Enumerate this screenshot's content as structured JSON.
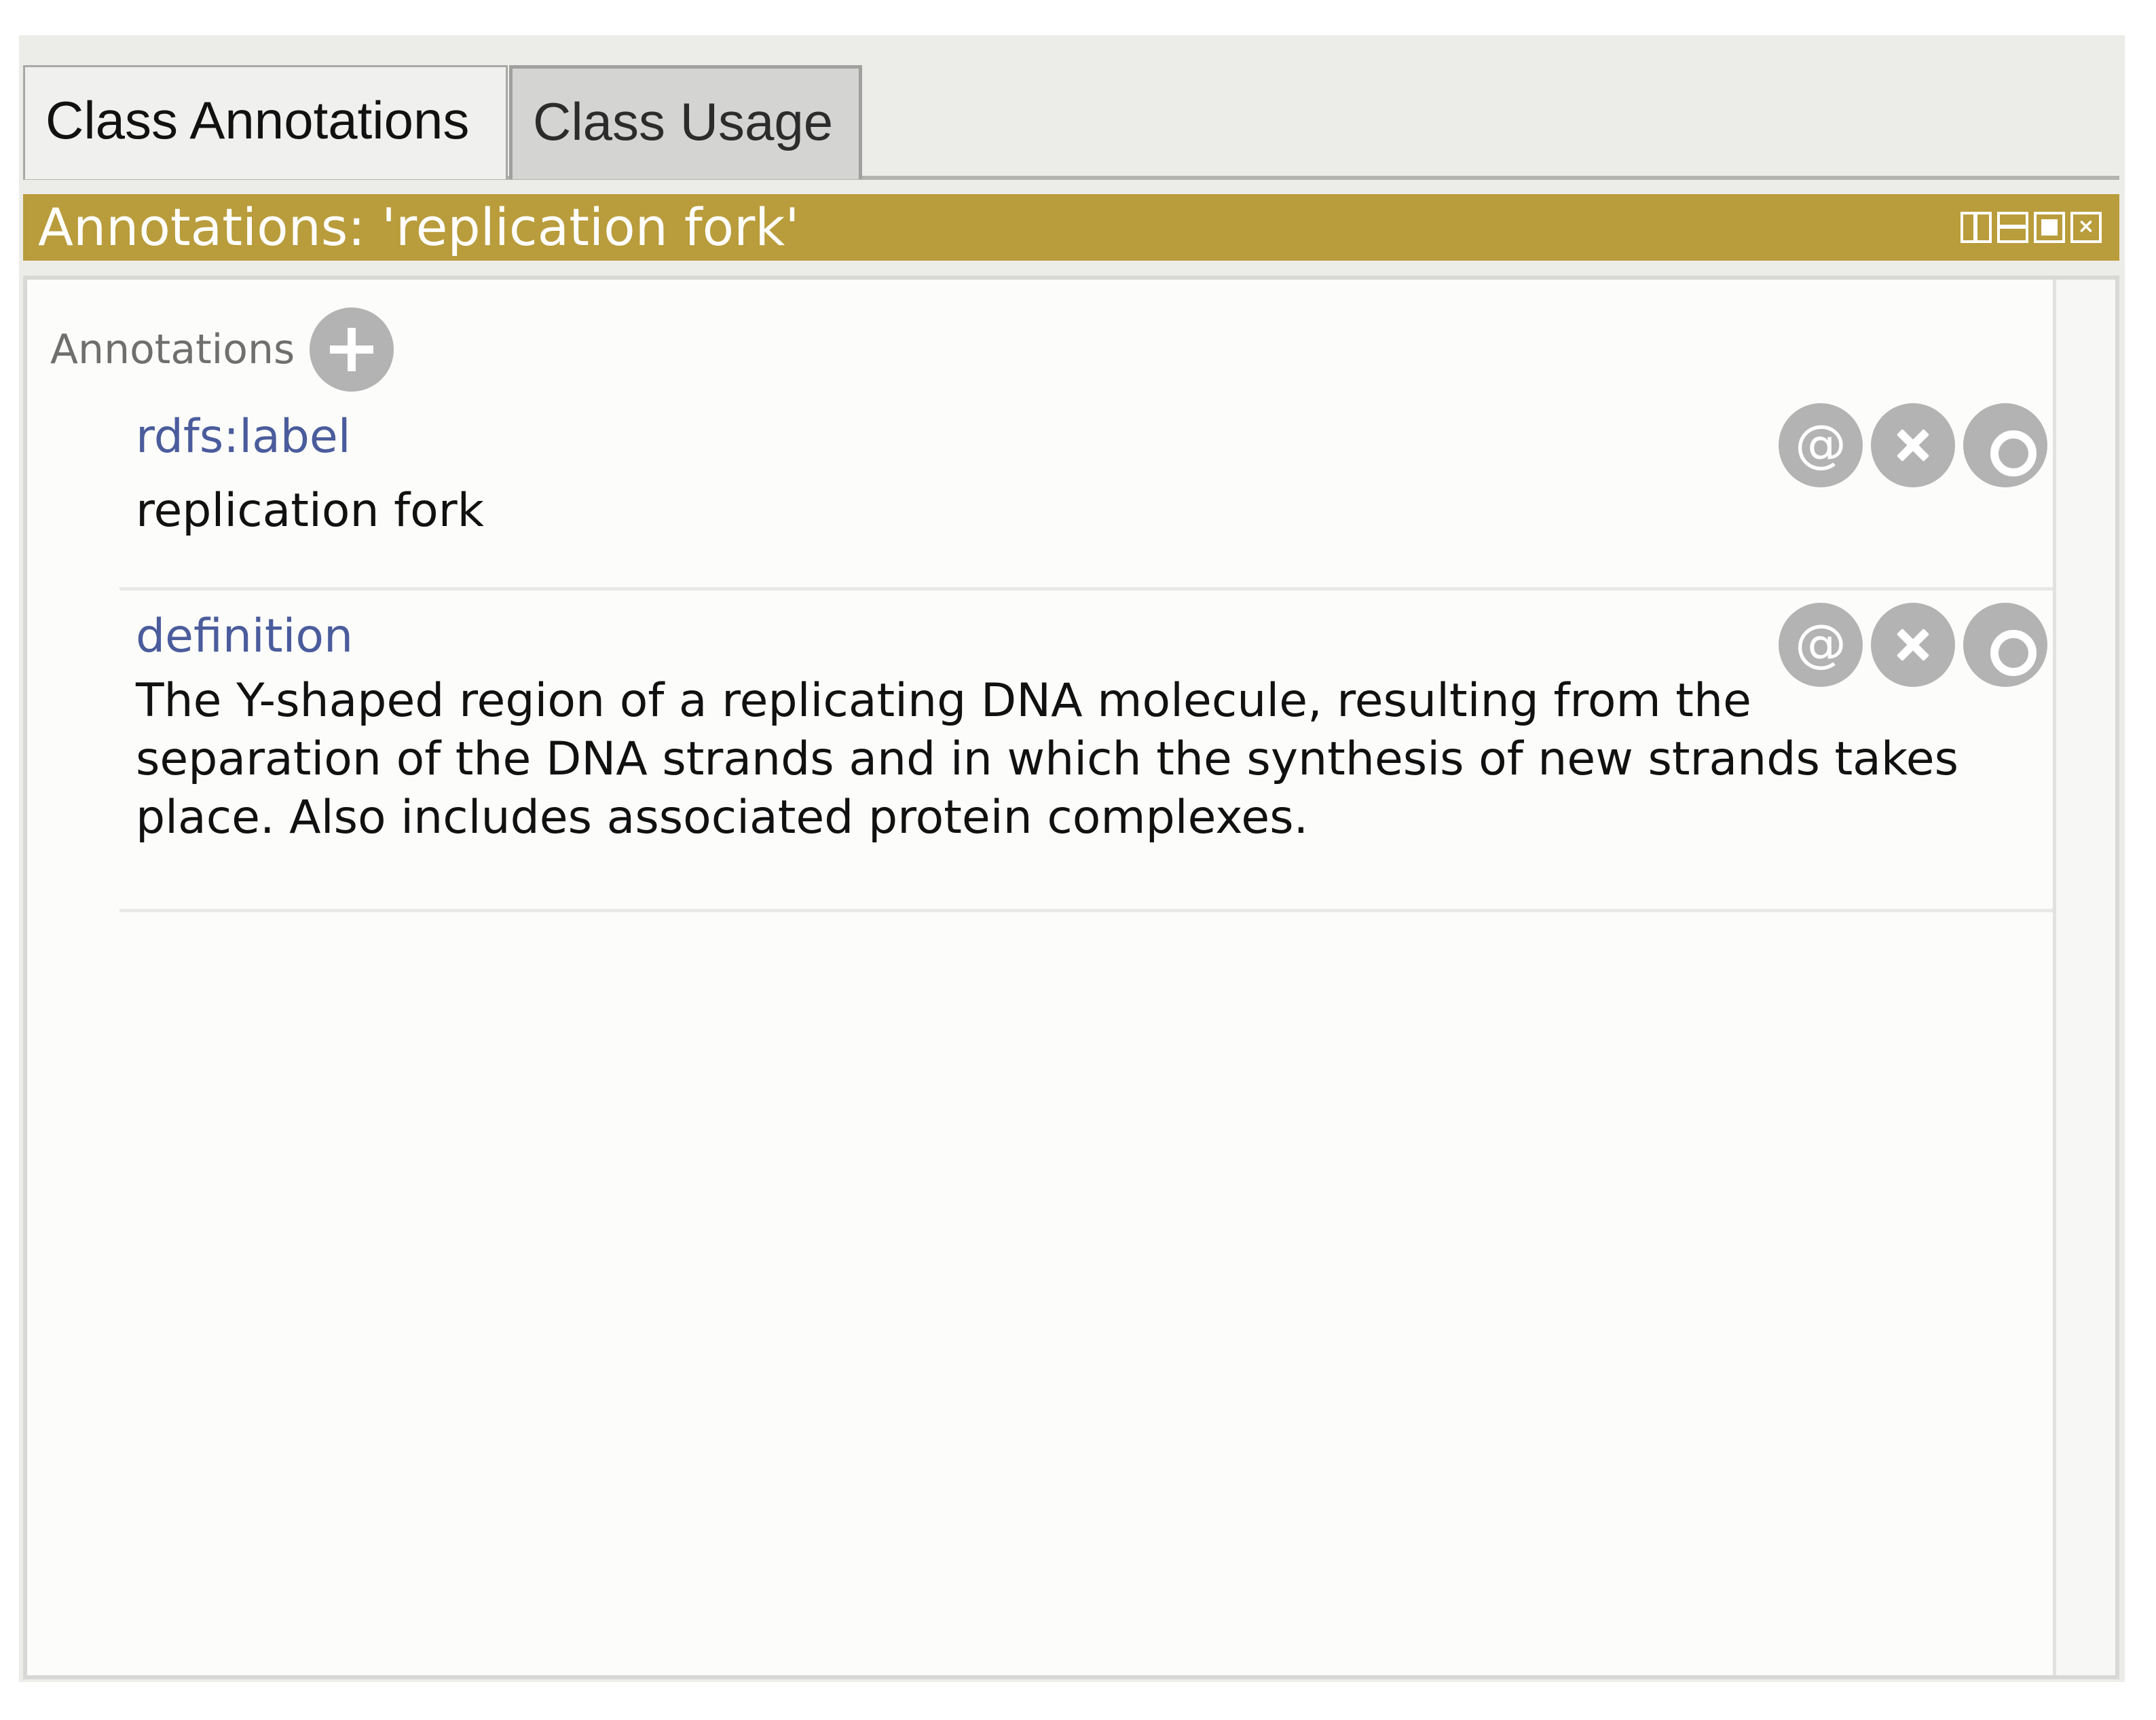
{
  "tabs": [
    {
      "label": "Class Annotations",
      "active": true
    },
    {
      "label": "Class Usage",
      "active": false
    }
  ],
  "view": {
    "title": "Annotations: 'replication fork'",
    "accent_color": "#b99c3b",
    "controls": [
      "split-vertical-icon",
      "split-horizontal-icon",
      "maximize-icon",
      "close-icon"
    ]
  },
  "annotations_panel": {
    "section_label": "Annotations",
    "add_icon": "plus-icon",
    "items": [
      {
        "property": "rdfs:label",
        "value": "replication fork",
        "buttons": [
          {
            "icon": "at-icon",
            "glyph": "@"
          },
          {
            "icon": "delete-icon"
          },
          {
            "icon": "edit-icon"
          }
        ]
      },
      {
        "property": "definition",
        "value": "The Y-shaped region of a replicating DNA molecule, resulting from the separation of the DNA strands and in which the synthesis of new strands takes place. Also includes associated protein complexes.",
        "buttons": [
          {
            "icon": "at-icon",
            "glyph": "@"
          },
          {
            "icon": "delete-icon"
          },
          {
            "icon": "edit-icon"
          }
        ]
      }
    ]
  }
}
